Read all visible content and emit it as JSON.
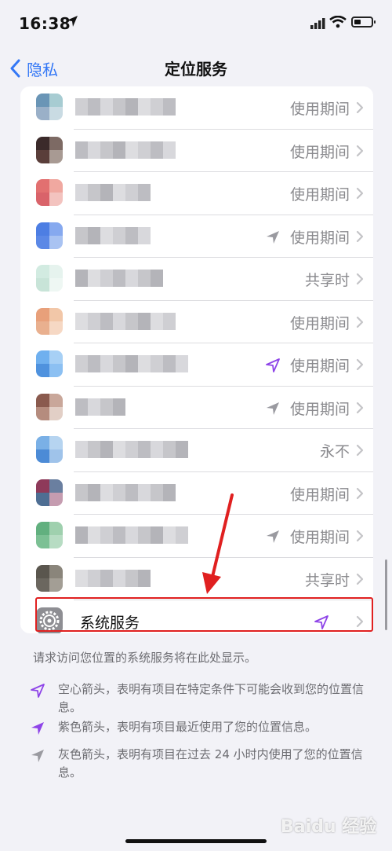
{
  "status_bar": {
    "time": "16:38"
  },
  "nav": {
    "back_label": "隐私",
    "title": "定位服务"
  },
  "apps": [
    {
      "value": "使用期间",
      "arrow": "none",
      "colors": [
        "#6a95b6",
        "#a7ccd2",
        "#9ab0c8",
        "#c9dbe3"
      ],
      "name_width": 130
    },
    {
      "value": "使用期间",
      "arrow": "none",
      "colors": [
        "#3b2a2a",
        "#7d6a64",
        "#5a3e3a",
        "#a89a93"
      ],
      "name_width": 120
    },
    {
      "value": "使用期间",
      "arrow": "none",
      "colors": [
        "#e27070",
        "#f0a8a0",
        "#d9636a",
        "#f3c3bf"
      ],
      "name_width": 90
    },
    {
      "value": "使用期间",
      "arrow": "gray",
      "colors": [
        "#4d7ee3",
        "#86a9ef",
        "#5b88e6",
        "#a9c3f2"
      ],
      "name_width": 90
    },
    {
      "value": "共享时",
      "arrow": "none",
      "colors": [
        "#d2ebe1",
        "#e6f3ee",
        "#c8e4d8",
        "#eef7f3"
      ],
      "name_width": 110
    },
    {
      "value": "使用期间",
      "arrow": "none",
      "colors": [
        "#e8a07a",
        "#f2c7a8",
        "#e9b08f",
        "#f6d8c4"
      ],
      "name_width": 120
    },
    {
      "value": "使用期间",
      "arrow": "purple-hollow",
      "colors": [
        "#6fb0ef",
        "#a7d0f5",
        "#4f92de",
        "#8cc0f2"
      ],
      "name_width": 140
    },
    {
      "value": "使用期间",
      "arrow": "gray",
      "colors": [
        "#8a5a4e",
        "#c9a79a",
        "#b58c7e",
        "#e2cfc6"
      ],
      "name_width": 70
    },
    {
      "value": "永不",
      "arrow": "none",
      "colors": [
        "#7ab0e6",
        "#b6d4f0",
        "#4c8bd6",
        "#9fc3ea"
      ],
      "name_width": 140
    },
    {
      "value": "使用期间",
      "arrow": "none",
      "colors": [
        "#8e3a5a",
        "#6a7fa0",
        "#4e6e93",
        "#c59cb0"
      ],
      "name_width": 120
    },
    {
      "value": "使用期间",
      "arrow": "gray",
      "colors": [
        "#62b07f",
        "#9fd0ae",
        "#7cc094",
        "#b7dcc3"
      ],
      "name_width": 140
    },
    {
      "value": "共享时",
      "arrow": "none",
      "colors": [
        "#5a564e",
        "#8a857b",
        "#6b675f",
        "#a39e95"
      ],
      "name_width": 100
    }
  ],
  "system_services": {
    "label": "系统服务",
    "arrow": "purple-hollow"
  },
  "footer": {
    "note": "请求访问您位置的系统服务将在此处显示。",
    "legend": [
      {
        "icon": "hollow-arrow-icon",
        "text": "空心箭头，表明有项目在特定条件下可能会收到您的位置信息。"
      },
      {
        "icon": "purple-arrow-icon",
        "text": "紫色箭头，表明有项目最近使用了您的位置信息。"
      },
      {
        "icon": "gray-arrow-icon",
        "text": "灰色箭头，表明有项目在过去 24 小时内使用了您的位置信息。"
      }
    ]
  },
  "watermark": "Baidu 经验",
  "colors": {
    "accent": "#3478f6",
    "purple": "#8e44e8",
    "gray_arrow": "#9a9aa0",
    "highlight": "#e02020"
  }
}
